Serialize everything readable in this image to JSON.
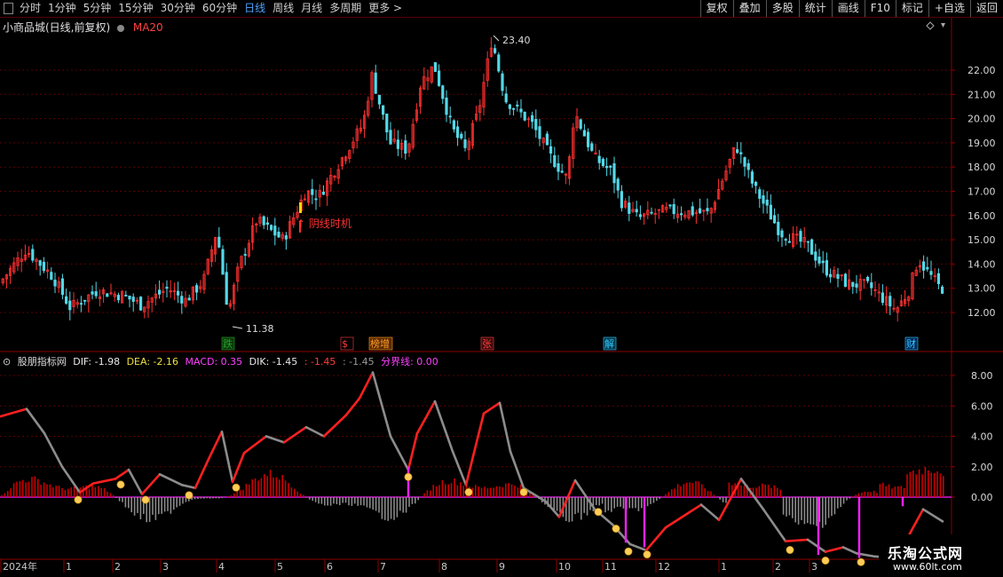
{
  "toolbar": {
    "periods": [
      "分时",
      "1分钟",
      "5分钟",
      "15分钟",
      "30分钟",
      "60分钟",
      "日线",
      "周线",
      "月线",
      "多周期",
      "更多 >"
    ],
    "active_period": "日线",
    "right_buttons": [
      "复权",
      "叠加",
      "多股",
      "统计",
      "画线",
      "F10",
      "标记",
      "+自选",
      "返回"
    ]
  },
  "main_panel": {
    "stock_title": "小商品城(日线,前复权)",
    "ma_label": "MA20",
    "high_label": "23.40",
    "low_label": "11.38",
    "arrow_text": "阴线时机",
    "y_ticks": [
      "22.00",
      "21.00",
      "20.00",
      "19.00",
      "18.00",
      "17.00",
      "16.00",
      "15.00",
      "14.00",
      "13.00",
      "12.00"
    ],
    "event_tags": [
      {
        "text": "跌",
        "color": "#28a028",
        "bg": "#0a3a0a"
      },
      {
        "text": "$",
        "color": "#ff4040",
        "bg": "#000"
      },
      {
        "text": "榜增",
        "color": "#ff9c2a",
        "bg": "#5a2a00"
      },
      {
        "text": "张",
        "color": "#ff4040",
        "bg": "#3a0a0a"
      },
      {
        "text": "解",
        "color": "#36c8ff",
        "bg": "#003a4a"
      },
      {
        "text": "财",
        "color": "#36c8ff",
        "bg": "#002a5a"
      }
    ]
  },
  "indicator_panel": {
    "name": "股朋指标网",
    "dif_label": "DIF: -1.98",
    "dea_label": "DEA: -2.16",
    "macd_label": "MACD: 0.35",
    "dik_label": "DIK: -1.45",
    "extra1": ": -1.45",
    "extra2": ": -1.45",
    "boundary_label": "分界线: 0.00",
    "y_ticks": [
      "8.00",
      "6.00",
      "4.00",
      "2.00",
      "0.00"
    ]
  },
  "time_axis": {
    "labels": [
      "2024年",
      "1",
      "2",
      "3",
      "4",
      "5",
      "6",
      "7",
      "8",
      "9",
      "10",
      "11",
      "12",
      "1",
      "2",
      "3"
    ]
  },
  "watermark": {
    "line1": "乐淘公式网",
    "line2": "www.60lt.com"
  },
  "colors": {
    "up": "#ff3030",
    "down": "#54d8e8",
    "grid": "#5a0000",
    "macd_pos": "#cc0000",
    "macd_neg": "#8a8a8a",
    "dif_up": "#ff2020",
    "dif_down": "#8c8c8c",
    "signal": "#ff20ff"
  }
}
